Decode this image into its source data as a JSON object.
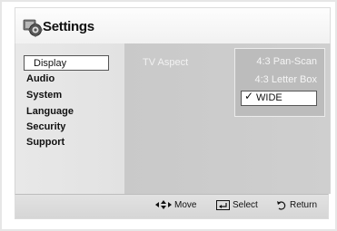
{
  "header": {
    "title": "Settings",
    "icon": "settings-gear-icon"
  },
  "sidebar": {
    "items": [
      {
        "label": "Display",
        "selected": true
      },
      {
        "label": "Audio",
        "selected": false
      },
      {
        "label": "System",
        "selected": false
      },
      {
        "label": "Language",
        "selected": false
      },
      {
        "label": "Security",
        "selected": false
      },
      {
        "label": "Support",
        "selected": false
      }
    ]
  },
  "content": {
    "setting_label": "TV Aspect",
    "options": [
      {
        "label": "4:3 Pan-Scan",
        "selected": false
      },
      {
        "label": "4:3 Letter Box",
        "selected": false
      },
      {
        "label": "WIDE",
        "selected": true
      }
    ],
    "check_mark": "✓"
  },
  "footer": {
    "move_label": "Move",
    "select_label": "Select",
    "return_label": "Return",
    "move_icon": "directional-arrows-icon",
    "select_icon": "enter-icon",
    "return_icon": "return-icon"
  },
  "colors": {
    "panel_border": "#e6e6e6",
    "sidebar_bg": "#e4e4e4",
    "content_bg": "#cccccc",
    "footer_bg": "#dcdcdc"
  }
}
